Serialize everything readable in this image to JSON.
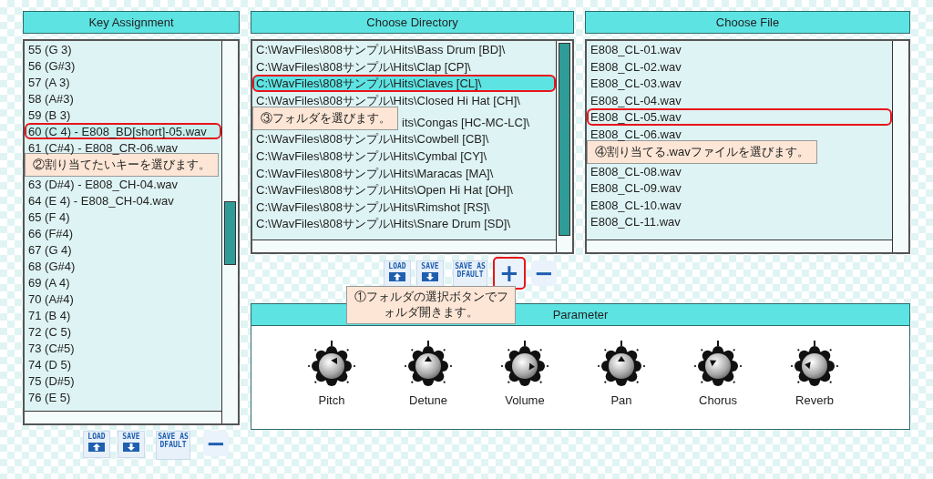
{
  "key_assignment": {
    "title": "Key Assignment",
    "rows": [
      {
        "kind": "row",
        "text": "55 (G 3)",
        "selected": false,
        "highlighted": false
      },
      {
        "kind": "row",
        "text": "56 (G#3)",
        "selected": false,
        "highlighted": false
      },
      {
        "kind": "row",
        "text": "57 (A 3)",
        "selected": false,
        "highlighted": false
      },
      {
        "kind": "row",
        "text": "58 (A#3)",
        "selected": false,
        "highlighted": false
      },
      {
        "kind": "row",
        "text": "59 (B 3)",
        "selected": false,
        "highlighted": false
      },
      {
        "kind": "row",
        "text": "60 (C 4) - E808_BD[short]-05.wav",
        "selected": true,
        "highlighted": true
      },
      {
        "kind": "row",
        "text": "61 (C#4) - E808_CR-06.wav",
        "selected": false,
        "highlighted": false
      },
      {
        "kind": "note",
        "text": "②割り当てたいキーを選びます。"
      },
      {
        "kind": "row",
        "text": "63 (D#4) - E808_CH-04.wav",
        "selected": false,
        "highlighted": false
      },
      {
        "kind": "row",
        "text": "64 (E 4) - E808_CH-04.wav",
        "selected": false,
        "highlighted": false
      },
      {
        "kind": "row",
        "text": "65 (F 4)",
        "selected": false,
        "highlighted": false
      },
      {
        "kind": "row",
        "text": "66 (F#4)",
        "selected": false,
        "highlighted": false
      },
      {
        "kind": "row",
        "text": "67 (G 4)",
        "selected": false,
        "highlighted": false
      },
      {
        "kind": "row",
        "text": "68 (G#4)",
        "selected": false,
        "highlighted": false
      },
      {
        "kind": "row",
        "text": "69 (A 4)",
        "selected": false,
        "highlighted": false
      },
      {
        "kind": "row",
        "text": "70 (A#4)",
        "selected": false,
        "highlighted": false
      },
      {
        "kind": "row",
        "text": "71 (B 4)",
        "selected": false,
        "highlighted": false
      },
      {
        "kind": "row",
        "text": "72 (C 5)",
        "selected": false,
        "highlighted": false
      },
      {
        "kind": "row",
        "text": "73 (C#5)",
        "selected": false,
        "highlighted": false
      },
      {
        "kind": "row",
        "text": "74 (D 5)",
        "selected": false,
        "highlighted": false
      },
      {
        "kind": "row",
        "text": "75 (D#5)",
        "selected": false,
        "highlighted": false
      },
      {
        "kind": "row",
        "text": "76 (E 5)",
        "selected": false,
        "highlighted": false
      }
    ],
    "buttons": [
      {
        "kind": "load",
        "label": "LOAD",
        "highlighted": false
      },
      {
        "kind": "save",
        "label": "SAVE",
        "highlighted": false
      },
      {
        "kind": "default",
        "label": "SAVE AS DFAULT",
        "highlighted": false
      },
      {
        "kind": "minus",
        "label": "−",
        "highlighted": false
      }
    ]
  },
  "choose_directory": {
    "title": "Choose Directory",
    "rows": [
      {
        "kind": "row",
        "text": "C:\\WavFiles\\808サンプル\\Hits\\Bass Drum [BD]\\",
        "selected": false,
        "highlighted": false
      },
      {
        "kind": "row",
        "text": "C:\\WavFiles\\808サンプル\\Hits\\Clap [CP]\\",
        "selected": false,
        "highlighted": false
      },
      {
        "kind": "row",
        "text": "C:\\WavFiles\\808サンプル\\Hits\\Claves [CL]\\",
        "selected": true,
        "highlighted": true
      },
      {
        "kind": "row",
        "text": "C:\\WavFiles\\808サンプル\\Hits\\Closed Hi Hat [CH]\\",
        "selected": false,
        "highlighted": false
      },
      {
        "kind": "noted_row",
        "note": "③フォルダを選びます。",
        "text": "its\\Congas [HC-MC-LC]\\",
        "selected": false,
        "highlighted": false
      },
      {
        "kind": "row",
        "text": "C:\\WavFiles\\808サンプル\\Hits\\Cowbell [CB]\\",
        "selected": false,
        "highlighted": false
      },
      {
        "kind": "row",
        "text": "C:\\WavFiles\\808サンプル\\Hits\\Cymbal [CY]\\",
        "selected": false,
        "highlighted": false
      },
      {
        "kind": "row",
        "text": "C:\\WavFiles\\808サンプル\\Hits\\Maracas [MA]\\",
        "selected": false,
        "highlighted": false
      },
      {
        "kind": "row",
        "text": "C:\\WavFiles\\808サンプル\\Hits\\Open Hi Hat [OH]\\",
        "selected": false,
        "highlighted": false
      },
      {
        "kind": "row",
        "text": "C:\\WavFiles\\808サンプル\\Hits\\Rimshot [RS]\\",
        "selected": false,
        "highlighted": false
      },
      {
        "kind": "row",
        "text": "C:\\WavFiles\\808サンプル\\Hits\\Snare Drum [SD]\\",
        "selected": false,
        "highlighted": false
      }
    ],
    "buttons": [
      {
        "kind": "load",
        "label": "LOAD",
        "highlighted": false
      },
      {
        "kind": "save",
        "label": "SAVE",
        "highlighted": false
      },
      {
        "kind": "default",
        "label": "SAVE AS DFAULT",
        "highlighted": false
      },
      {
        "kind": "plus",
        "label": "+",
        "highlighted": true
      },
      {
        "kind": "minus",
        "label": "−",
        "highlighted": false
      }
    ],
    "button_note": "①フォルダの選択ボタンでフォルダ開きます。"
  },
  "choose_file": {
    "title": "Choose File",
    "rows": [
      {
        "kind": "row",
        "text": "E808_CL-01.wav",
        "selected": false,
        "highlighted": false
      },
      {
        "kind": "row",
        "text": "E808_CL-02.wav",
        "selected": false,
        "highlighted": false
      },
      {
        "kind": "row",
        "text": "E808_CL-03.wav",
        "selected": false,
        "highlighted": false
      },
      {
        "kind": "row",
        "text": "E808_CL-04.wav",
        "selected": false,
        "highlighted": false
      },
      {
        "kind": "row",
        "text": "E808_CL-05.wav",
        "selected": false,
        "highlighted": true
      },
      {
        "kind": "row",
        "text": "E808_CL-06.wav",
        "selected": false,
        "highlighted": false
      },
      {
        "kind": "note",
        "text": "④割り当てる.wavファイルを選びます。"
      },
      {
        "kind": "row",
        "text": "E808_CL-08.wav",
        "selected": false,
        "highlighted": false
      },
      {
        "kind": "row",
        "text": "E808_CL-09.wav",
        "selected": false,
        "highlighted": false
      },
      {
        "kind": "row",
        "text": "E808_CL-10.wav",
        "selected": false,
        "highlighted": false
      },
      {
        "kind": "row",
        "text": "E808_CL-11.wav",
        "selected": false,
        "highlighted": false
      }
    ]
  },
  "parameter": {
    "title": "Parameter",
    "knobs": [
      {
        "label": "Pitch",
        "level": 0.62
      },
      {
        "label": "Detune",
        "level": 0.5
      },
      {
        "label": "Volume",
        "level": 0.85
      },
      {
        "label": "Pan",
        "level": 0.5
      },
      {
        "label": "Chorus",
        "level": 0.3
      },
      {
        "label": "Reverb",
        "level": 0.2
      }
    ]
  }
}
